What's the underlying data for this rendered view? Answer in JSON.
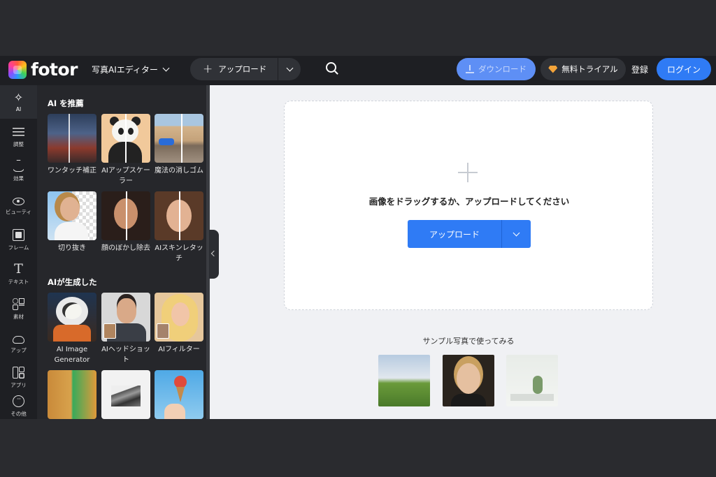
{
  "header": {
    "logo_text": "fotor",
    "editor_menu": "写真AIエディター",
    "upload_label": "アップロード",
    "download_label": "ダウンロード",
    "trial_label": "無料トライアル",
    "register_label": "登録",
    "login_label": "ログイン"
  },
  "rail": [
    {
      "label": "AI"
    },
    {
      "label": "調整"
    },
    {
      "label": "効果"
    },
    {
      "label": "ビューティ"
    },
    {
      "label": "フレーム"
    },
    {
      "label": "テキスト"
    },
    {
      "label": "素材"
    },
    {
      "label": "アップ"
    },
    {
      "label": "アプリ"
    },
    {
      "label": "その他"
    }
  ],
  "panel": {
    "section1_title": "AI を推薦",
    "section2_title": "AIが生成した",
    "tools": [
      {
        "label": "ワンタッチ補正"
      },
      {
        "label": "AIアップスケーラー"
      },
      {
        "label": "魔法の消しゴム"
      },
      {
        "label": "切り抜き"
      },
      {
        "label": "顔のぼかし除去"
      },
      {
        "label": "AIスキンレタッチ"
      },
      {
        "label": "AI Image Generator"
      },
      {
        "label": "AIヘッドショット"
      },
      {
        "label": "AIフィルター"
      }
    ]
  },
  "workspace": {
    "drop_text": "画像をドラッグするか、アップロードしてください",
    "upload_button": "アップロード",
    "sample_title": "サンプル写真で使ってみる"
  },
  "colors": {
    "accent": "#2f7bf5",
    "topbar": "#1e1f23",
    "panel": "#26272b",
    "workspace": "#f0f1f4"
  }
}
